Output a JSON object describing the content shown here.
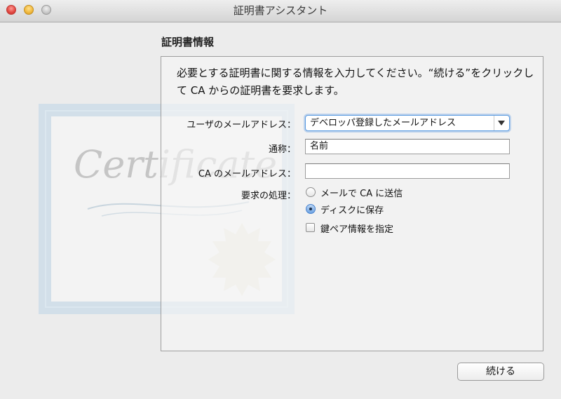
{
  "window": {
    "title": "証明書アシスタント"
  },
  "section": {
    "title": "証明書情報"
  },
  "intro": "必要とする証明書に関する情報を入力してください。“続ける”をクリックして CA からの証明書を要求します。",
  "background": {
    "cert_text": "Certificate"
  },
  "form": {
    "email_label": "ユーザのメールアドレス：",
    "email_value": "デベロッパ登録したメールアドレス",
    "common_name_label": "通称：",
    "common_name_value": "名前",
    "ca_email_label": "CA のメールアドレス：",
    "ca_email_value": "",
    "request_label": "要求の処理：",
    "option_email": "メールで CA に送信",
    "option_disk": "ディスクに保存",
    "option_disk_selected": true,
    "keypair_label": "鍵ペア情報を指定",
    "keypair_checked": false
  },
  "buttons": {
    "continue": "続ける"
  },
  "colors": {
    "accent": "#5b9be0",
    "close": "#e0443e",
    "minimize": "#f0b73b",
    "zoom": "#c8c8c8"
  }
}
